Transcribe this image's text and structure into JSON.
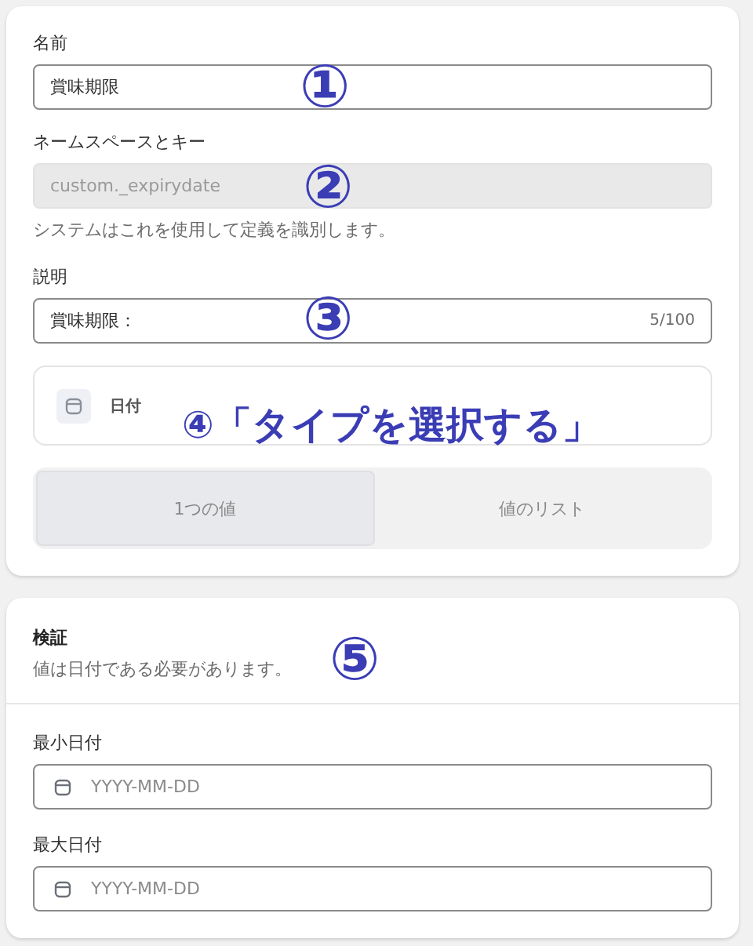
{
  "definition": {
    "name": {
      "label": "名前",
      "value": "賞味期限",
      "marker": "①"
    },
    "namespace": {
      "label": "ネームスペースとキー",
      "value": "custom._expirydate",
      "disabled": true,
      "help": "システムはこれを使用して定義を識別します。",
      "marker": "②"
    },
    "description": {
      "label": "説明",
      "value": "賞味期限：",
      "counter": "5/100",
      "marker": "③"
    },
    "type": {
      "label": "日付",
      "marker": "④「タイプを選択する」"
    },
    "cardinality": [
      {
        "label": "1つの値",
        "selected": true
      },
      {
        "label": "値のリスト",
        "selected": false
      }
    ]
  },
  "validation": {
    "title": "検証",
    "subtitle": "値は日付である必要があります。",
    "marker": "⑤",
    "fields": [
      {
        "label": "最小日付",
        "placeholder": "YYYY-MM-DD"
      },
      {
        "label": "最大日付",
        "placeholder": "YYYY-MM-DD"
      }
    ]
  }
}
